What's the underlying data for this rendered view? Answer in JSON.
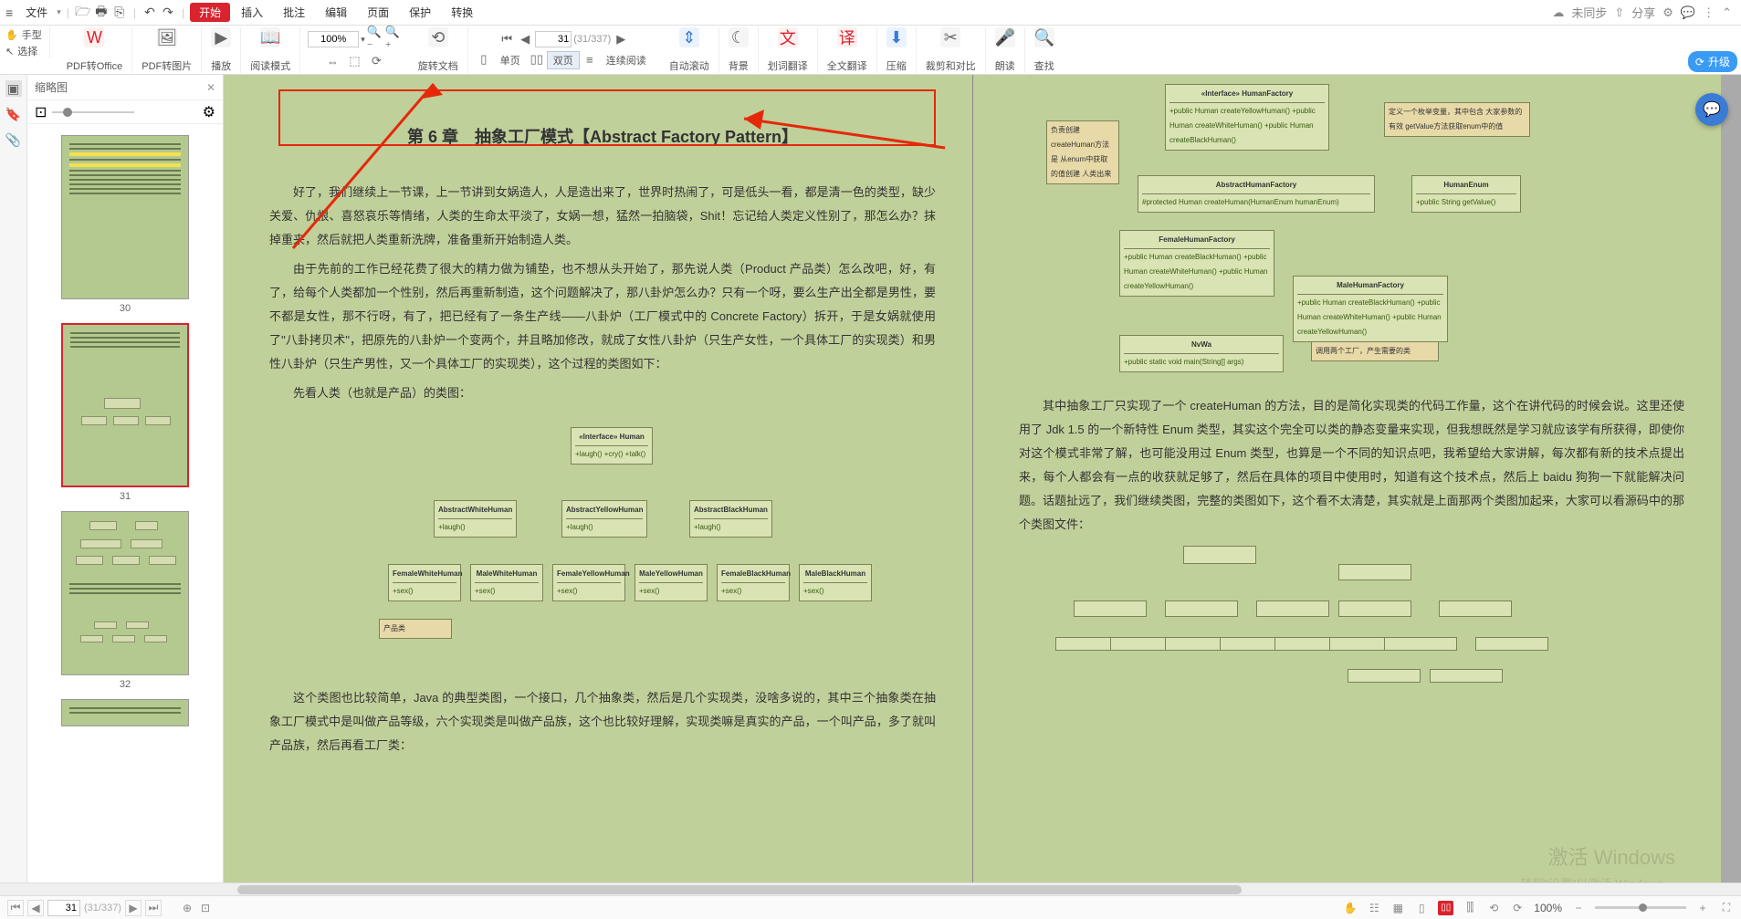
{
  "menubar": {
    "file": "文件",
    "tabs": [
      "开始",
      "插入",
      "批注",
      "编辑",
      "页面",
      "保护",
      "转换"
    ],
    "sync": "未同步",
    "share": "分享"
  },
  "ribbon": {
    "hand": "手型",
    "select": "选择",
    "pdf_to_office": "PDF转Office",
    "pdf_to_image": "PDF转图片",
    "play": "播放",
    "read_mode": "阅读模式",
    "zoom_value": "100%",
    "rotate": "旋转文档",
    "page_current": "31",
    "page_total": "(31/337)",
    "single_page": "单页",
    "double_page": "双页",
    "continuous": "连续阅读",
    "auto_scroll": "自动滚动",
    "background": "背景",
    "highlight_translate": "划词翻译",
    "full_translate": "全文翻译",
    "compress": "压缩",
    "crop_compare": "裁剪和对比",
    "read_aloud": "朗读",
    "find": "查找",
    "upgrade": "升级"
  },
  "thumb_panel": {
    "title": "缩略图",
    "pages": [
      30,
      31,
      32
    ]
  },
  "document": {
    "chapter_title": "第 6 章　抽象工厂模式【Abstract Factory Pattern】",
    "p1": "好了，我们继续上一节课，上一节讲到女娲造人，人是造出来了，世界时热闹了，可是低头一看，都是清一色的类型，缺少关爱、仇恨、喜怒哀乐等情绪，人类的生命太平淡了，女娲一想，猛然一拍脑袋，Shit！忘记给人类定义性别了，那怎么办？抹掉重来，然后就把人类重新洗牌，准备重新开始制造人类。",
    "p2": "由于先前的工作已经花费了很大的精力做为铺垫，也不想从头开始了，那先说人类（Product 产品类）怎么改吧，好，有了，给每个人类都加一个性别，然后再重新制造，这个问题解决了，那八卦炉怎么办？只有一个呀，要么生产出全都是男性，要不都是女性，那不行呀，有了，把已经有了一条生产线——八卦炉（工厂模式中的 Concrete Factory）拆开，于是女娲就使用了\"八卦拷贝术\"，把原先的八卦炉一个变两个，并且略加修改，就成了女性八卦炉（只生产女性，一个具体工厂的实现类）和男性八卦炉（只生产男性，又一个具体工厂的实现类），这个过程的类图如下：",
    "p3": "先看人类（也就是产品）的类图：",
    "p4": "这个类图也比较简单，Java 的典型类图，一个接口，几个抽象类，然后是几个实现类，没啥多说的，其中三个抽象类在抽象工厂模式中是叫做产品等级，六个实现类是叫做产品族，这个也比较好理解，实现类嘛是真实的产品，一个叫产品，多了就叫产品族，然后再看工厂类：",
    "right_p1": "其中抽象工厂只实现了一个 createHuman 的方法，目的是简化实现类的代码工作量，这个在讲代码的时候会说。这里还使用了 Jdk 1.5 的一个新特性 Enum 类型，其实这个完全可以类的静态变量来实现，但我想既然是学习就应该学有所获得，即使你对这个模式非常了解，也可能没用过 Enum 类型，也算是一个不同的知识点吧，我希望给大家讲解，每次都有新的技术点提出来，每个人都会有一点的收获就足够了，然后在具体的项目中使用时，知道有这个技术点，然后上 baidu 狗狗一下就能解决问题。话题扯远了，我们继续类图，完整的类图如下，这个看不太清楚，其实就是上面那两个类图加起来，大家可以看源码中的那个类图文件：",
    "uml_left": {
      "interface": "«Interface»\\nHuman",
      "interface_methods": "+laugh()\\n+cry()\\n+talk()",
      "abstract_white": "AbstractWhiteHuman",
      "abstract_yellow": "AbstractYellowHuman",
      "abstract_black": "AbstractBlackHuman",
      "female_white": "FemaleWhiteHuman",
      "male_white": "MaleWhiteHuman",
      "female_yellow": "FemaleYellowHuman",
      "male_yellow": "MaleYellowHuman",
      "female_black": "FemaleBlackHuman",
      "male_black": "MaleBlackHuman",
      "note": "产品类"
    },
    "uml_right": {
      "note1": "负责创建\\ncreateHuman方法是\\n从enum中获取的值创建\\n人类出来",
      "interface": "«Interface»\\nHumanFactory",
      "interface_methods": "+public Human createYellowHuman()\\n+public Human createWhiteHuman()\\n+public Human createBlackHuman()",
      "note2": "定义一个枚举变量，其中包含\\n大家参数的有效\\ngetValue方法获取enum中的值",
      "abstract_factory": "AbstractHumanFactory",
      "abstract_factory_m": "#protected Human createHuman(HumanEnum humanEnum)",
      "human_enum": "HumanEnum",
      "human_enum_m": "+public String getValue()",
      "female_factory": "FemaleHumanFactory",
      "female_factory_m": "+public Human createBlackHuman()\\n+public Human createWhiteHuman()\\n+public Human createYellowHuman()",
      "male_factory": "MaleHumanFactory",
      "male_factory_m": "+public Human createBlackHuman()\\n+public Human createWhiteHuman()\\n+public Human createYellowHuman()",
      "nvwa": "NvWa",
      "nvwa_m": "+public static void main(String[] args)",
      "note3": "调用两个工厂，产生需要的类"
    }
  },
  "watermark": {
    "main": "激活 Windows",
    "sub": "转到\"设置\"以激活 Windows。"
  },
  "statusbar": {
    "page_current": "31",
    "page_total": "(31/337)",
    "zoom": "100%"
  }
}
